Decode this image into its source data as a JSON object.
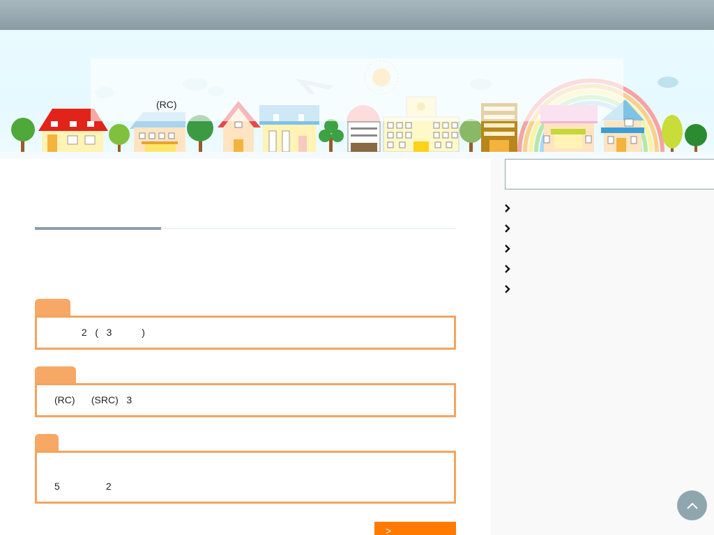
{
  "hero": {
    "caption": "(RC)"
  },
  "sidebar": {
    "search_placeholder": "",
    "menu_icon": "chevron-right-icon",
    "items": [
      {
        "label": ""
      },
      {
        "label": ""
      },
      {
        "label": ""
      },
      {
        "label": ""
      },
      {
        "label": ""
      }
    ]
  },
  "main": {
    "info_sections": [
      {
        "tab_label": "",
        "text": "          2   (   3           )"
      },
      {
        "tab_label": "",
        "text": "(RC)      (SRC)   3"
      },
      {
        "tab_label": "",
        "text": "5                 2"
      }
    ],
    "more_button_label": ">"
  },
  "scroll_top": {
    "icon": "chevron-up-icon"
  },
  "colors": {
    "accent_orange": "#f4a45e",
    "button_orange": "#ff7a00",
    "header_gray": "#8a9ba3"
  }
}
